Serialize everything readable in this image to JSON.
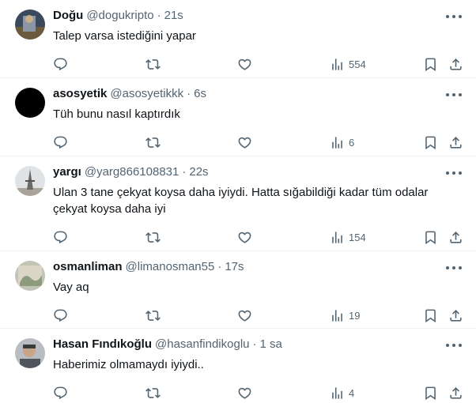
{
  "colors": {
    "text_primary": "#0f1419",
    "text_secondary": "#536471",
    "divider": "#eff3f4"
  },
  "icons": {
    "reply": "reply-icon",
    "retweet": "retweet-icon",
    "like": "heart-icon",
    "views": "views-bar-chart-icon",
    "bookmark": "bookmark-icon",
    "share": "share-icon",
    "more": "more-dots-icon"
  },
  "tweets": [
    {
      "name": "Doğu",
      "handle": "@dogukripto",
      "separator": "·",
      "time": "21s",
      "text": "Talep varsa istediğini yapar",
      "views": "554"
    },
    {
      "name": "asosyetik",
      "handle": "@asosyetikkk",
      "separator": "·",
      "time": "6s",
      "text": "Tüh bunu nasıl kaptırdık",
      "views": "6"
    },
    {
      "name": "yargı",
      "handle": "@yarg866108831",
      "separator": "·",
      "time": "22s",
      "text": "Ulan 3 tane çekyat koysa daha iyiydi. Hatta sığabildiği kadar tüm odalar\nçekyat koysa daha iyi",
      "views": "154"
    },
    {
      "name": "osmanliman",
      "handle": "@limanosman55",
      "separator": "·",
      "time": "17s",
      "text": "Vay aq",
      "views": "19"
    },
    {
      "name": "Hasan Fındıkoğlu",
      "handle": "@hasanfindikoglu",
      "separator": "·",
      "time": "1 sa",
      "text": "Haberimiz olmamaydı iyiydi..",
      "views": "4"
    }
  ]
}
